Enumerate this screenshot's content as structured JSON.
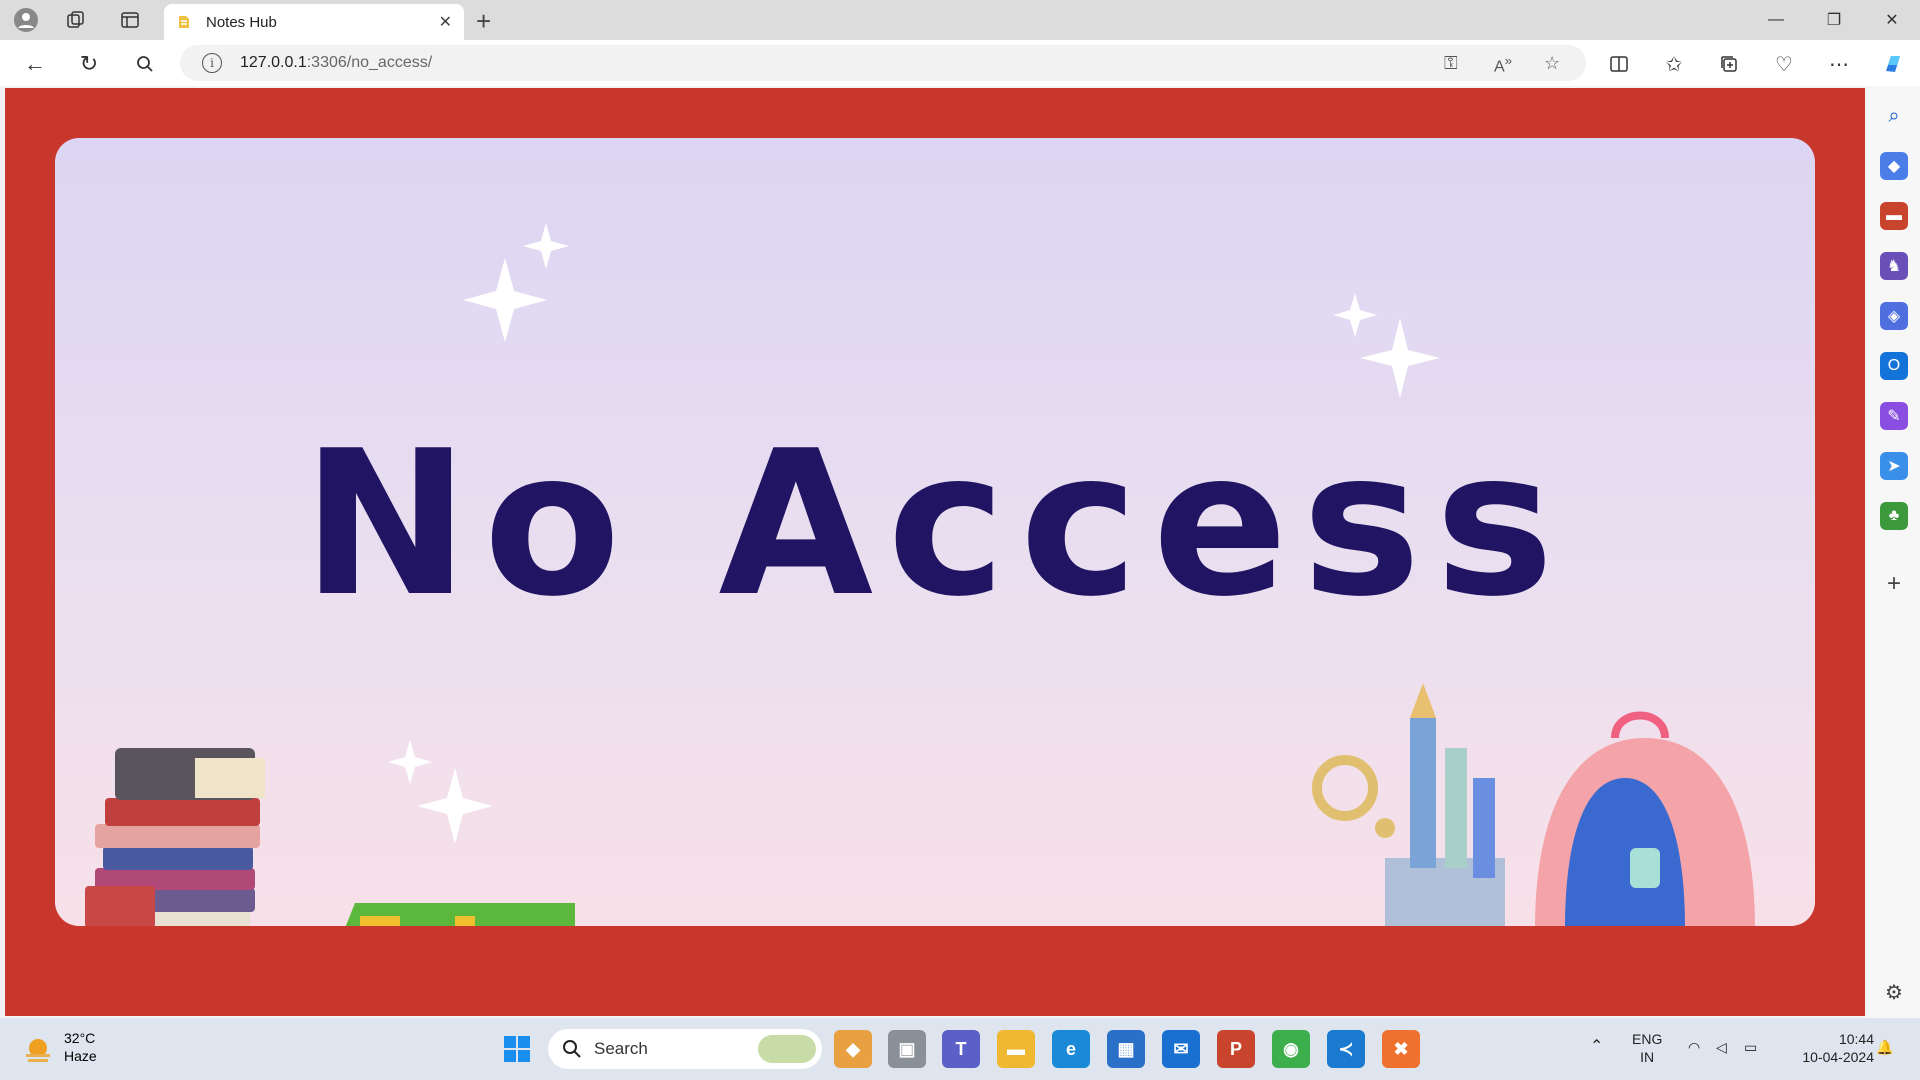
{
  "browser": {
    "tab_title": "Notes Hub",
    "url_host": "127.0.0.1",
    "url_rest": ":3306/no_access/"
  },
  "page": {
    "headline": "No Access",
    "background_color": "#c8372b",
    "card_gradient": [
      "#dcd5f3",
      "#f8e0e8"
    ],
    "text_color": "#211462"
  },
  "taskbar": {
    "weather_temp": "32°C",
    "weather_desc": "Haze",
    "search_placeholder": "Search",
    "lang_line1": "ENG",
    "lang_line2": "IN",
    "time": "10:44",
    "date": "10-04-2024"
  },
  "icons": [
    "profile-icon",
    "workspaces-icon",
    "tab-actions-icon",
    "close-icon",
    "new-tab-icon",
    "back-icon",
    "refresh-icon",
    "search-icon",
    "info-icon",
    "key-icon",
    "read-aloud-icon",
    "favorite-star-icon",
    "split-screen-icon",
    "favorites-icon",
    "collections-icon",
    "health-icon",
    "more-icon",
    "copilot-icon"
  ]
}
